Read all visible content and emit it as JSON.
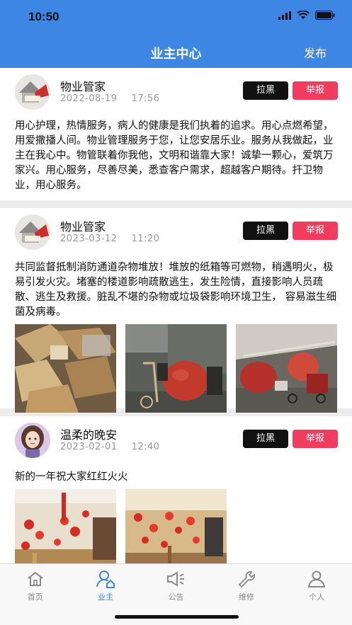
{
  "status_bar": {
    "time": "10:50"
  },
  "header": {
    "title": "业主中心",
    "publish_label": "发布"
  },
  "buttons": {
    "block_label": "拉黑",
    "report_label": "举报"
  },
  "posts": [
    {
      "author": "物业管家",
      "date": "2022-08-19",
      "time": "17:56",
      "content": "用心护理，热情服务，病人的健康是我们执着的追求。用心点燃希望，用爱撒播人间。物业管理服务于您，让您安居乐业。服务从我做起，业主在我心中。物管联着你我他，文明和谐靠大家！诚挚一颗心，爱筑万家兴。用心服务，尽善尽美，悉查客户需求，超越客户期待。扞卫物业，用心服务。"
    },
    {
      "author": "物业管家",
      "date": "2023-03-12",
      "time": "11:20",
      "content": "共同监督抵制消防通道杂物堆放！堆放的纸箱等可燃物，稍遇明火，极易引发火灾。堵塞的楼道影响疏散逃生，发生险情，直接影响人员疏散、逃生及救援。脏乱不堪的杂物或垃圾袋影响环境卫生， 容易滋生细菌及病毒。"
    },
    {
      "author": "温柔的晚安",
      "date": "2023-02-01",
      "time": "12:40",
      "content": "新的一年祝大家红红火火"
    }
  ],
  "tabbar": {
    "items": [
      {
        "label": "首页",
        "icon": "home-icon"
      },
      {
        "label": "业主",
        "icon": "owner-icon"
      },
      {
        "label": "公告",
        "icon": "announcement-icon"
      },
      {
        "label": "维修",
        "icon": "wrench-icon"
      },
      {
        "label": "个人",
        "icon": "person-icon"
      }
    ],
    "active_index": 1
  },
  "colors": {
    "header": "#3e86e4",
    "block_button": "#111111",
    "report_button": "#f03c5f",
    "active_tab": "#3e86e4"
  }
}
